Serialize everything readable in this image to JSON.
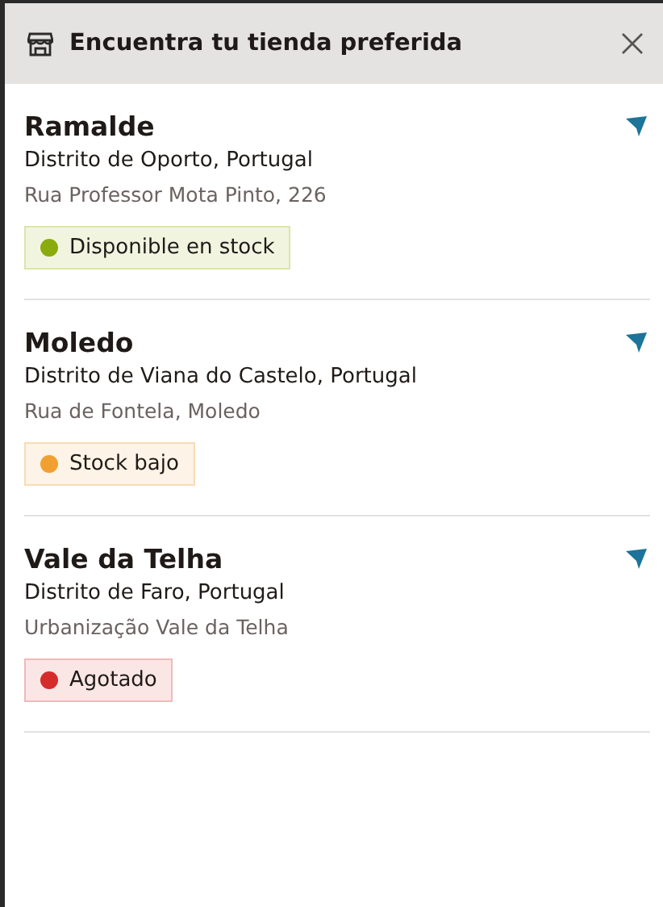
{
  "header": {
    "title": "Encuentra tu tienda preferida"
  },
  "stores": [
    {
      "name": "Ramalde",
      "district": "Distrito de Oporto, Portugal",
      "address": "Rua Professor Mota Pinto, 226",
      "stock": {
        "kind": "in_stock",
        "label": "Disponible en stock",
        "color": "#8aab0c"
      }
    },
    {
      "name": "Moledo",
      "district": "Distrito de Viana do Castelo, Portugal",
      "address": "Rua de Fontela, Moledo",
      "stock": {
        "kind": "low",
        "label": "Stock bajo",
        "color": "#f0a030"
      }
    },
    {
      "name": "Vale da Telha",
      "district": "Distrito de Faro, Portugal",
      "address": "Urbanização Vale da Telha",
      "stock": {
        "kind": "out",
        "label": "Agotado",
        "color": "#d62b2b"
      }
    }
  ]
}
